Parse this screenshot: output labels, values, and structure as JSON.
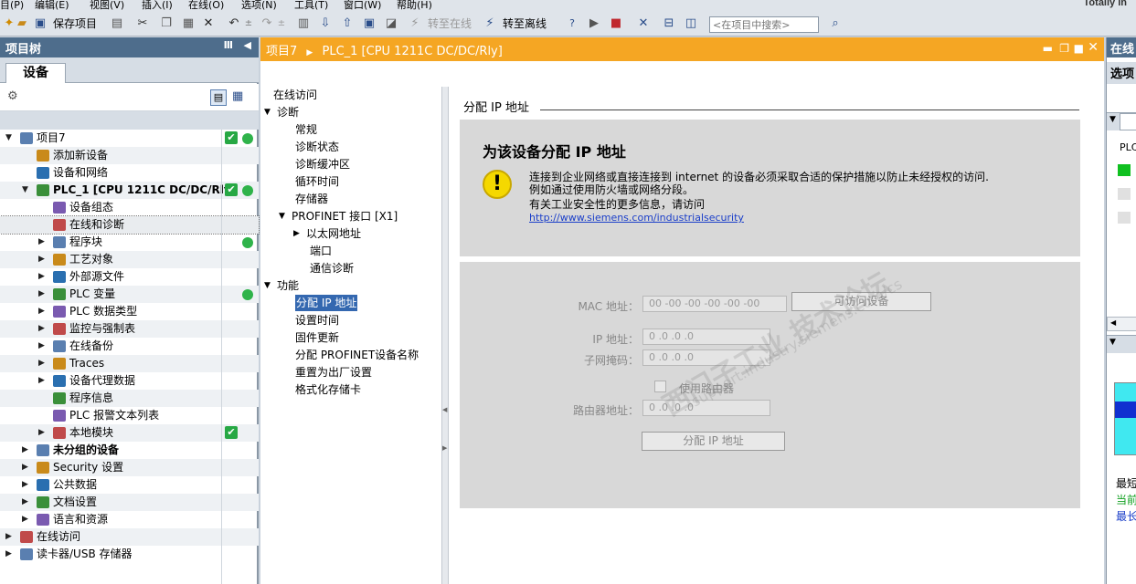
{
  "menu": [
    "目(P)",
    "编辑(E)",
    "视图(V)",
    "插入(I)",
    "在线(O)",
    "选项(N)",
    "工具(T)",
    "窗口(W)",
    "帮助(H)"
  ],
  "brand": "Totally In",
  "toolbar": {
    "save_label": "保存项目",
    "go_online": "转至在线",
    "go_offline": "转至离线",
    "search_placeholder": "<在项目中搜索>"
  },
  "left_panel": {
    "title": "项目树",
    "tab": "设备",
    "tree": [
      {
        "label": "项目7",
        "indent": 0,
        "expanded": true,
        "check": true,
        "dot": true
      },
      {
        "label": "添加新设备",
        "indent": 1
      },
      {
        "label": "设备和网络",
        "indent": 1
      },
      {
        "label": "PLC_1 [CPU 1211C DC/DC/Rly]",
        "indent": 1,
        "expanded": true,
        "check": true,
        "dot": true,
        "bold": true
      },
      {
        "label": "设备组态",
        "indent": 2
      },
      {
        "label": "在线和诊断",
        "indent": 2,
        "selected": true
      },
      {
        "label": "程序块",
        "indent": 2,
        "collapsed": true,
        "dot": true
      },
      {
        "label": "工艺对象",
        "indent": 2,
        "collapsed": true
      },
      {
        "label": "外部源文件",
        "indent": 2,
        "collapsed": true
      },
      {
        "label": "PLC 变量",
        "indent": 2,
        "collapsed": true,
        "dot": true
      },
      {
        "label": "PLC 数据类型",
        "indent": 2,
        "collapsed": true
      },
      {
        "label": "监控与强制表",
        "indent": 2,
        "collapsed": true
      },
      {
        "label": "在线备份",
        "indent": 2,
        "collapsed": true
      },
      {
        "label": "Traces",
        "indent": 2,
        "collapsed": true
      },
      {
        "label": "设备代理数据",
        "indent": 2,
        "collapsed": true
      },
      {
        "label": "程序信息",
        "indent": 2
      },
      {
        "label": "PLC 报警文本列表",
        "indent": 2
      },
      {
        "label": "本地模块",
        "indent": 2,
        "collapsed": true,
        "check": true
      },
      {
        "label": "未分组的设备",
        "indent": 1,
        "collapsed": true,
        "bold": true
      },
      {
        "label": "Security 设置",
        "indent": 1,
        "collapsed": true
      },
      {
        "label": "公共数据",
        "indent": 1,
        "collapsed": true
      },
      {
        "label": "文档设置",
        "indent": 1,
        "collapsed": true
      },
      {
        "label": "语言和资源",
        "indent": 1,
        "collapsed": true
      },
      {
        "label": "在线访问",
        "indent": 0,
        "collapsed": true
      },
      {
        "label": "读卡器/USB 存储器",
        "indent": 0,
        "collapsed": true
      }
    ]
  },
  "editor": {
    "breadcrumb_project": "项目7",
    "breadcrumb_device": "PLC_1 [CPU 1211C DC/DC/Rly]",
    "nav": [
      {
        "label": "在线访问",
        "indent": 0
      },
      {
        "label": "诊断",
        "indent": 0,
        "expanded": true
      },
      {
        "label": "常规",
        "indent": 1
      },
      {
        "label": "诊断状态",
        "indent": 1
      },
      {
        "label": "诊断缓冲区",
        "indent": 1
      },
      {
        "label": "循环时间",
        "indent": 1
      },
      {
        "label": "存储器",
        "indent": 1
      },
      {
        "label": "PROFINET 接口 [X1]",
        "indent": 1,
        "expanded": true
      },
      {
        "label": "以太网地址",
        "indent": 2,
        "collapsed": true
      },
      {
        "label": "端口",
        "indent": 2
      },
      {
        "label": "通信诊断",
        "indent": 2
      },
      {
        "label": "功能",
        "indent": 0,
        "expanded": true
      },
      {
        "label": "分配 IP 地址",
        "indent": 1,
        "selected": true
      },
      {
        "label": "设置时间",
        "indent": 1
      },
      {
        "label": "固件更新",
        "indent": 1
      },
      {
        "label": "分配 PROFINET设备名称",
        "indent": 1
      },
      {
        "label": "重置为出厂设置",
        "indent": 1
      },
      {
        "label": "格式化存储卡",
        "indent": 1
      }
    ],
    "section_title": "分配 IP 地址",
    "heading": "为该设备分配 IP 地址",
    "warning_line1": "连接到企业网络或直接连接到 internet 的设备必须采取合适的保护措施以防止未经授权的访问.",
    "warning_line2": "例如通过使用防火墙或网络分段。",
    "warning_line3": "有关工业安全性的更多信息，请访问",
    "warning_link": "http://www.siemens.com/industrialsecurity",
    "mac_label": "MAC 地址：",
    "mac_value": "00 -00 -00 -00 -00 -00",
    "accessible_devices_button": "可访问设备",
    "ip_label": "IP 地址：",
    "ip_value": "0    .0    .0    .0",
    "subnet_label": "子网掩码：",
    "subnet_value": "0    .0    .0    .0",
    "use_router_label": "使用路由器",
    "router_label": "路由器地址：",
    "router_value": "0    .0    .0    .0",
    "assign_button": "分配 IP 地址",
    "watermark": "西门子工业 技术论坛",
    "watermark_url": "support.industry.siemens.com/cs"
  },
  "right_panel": {
    "title": "在线",
    "tab": "选项",
    "item_plc": "PLC",
    "item_a": "最短",
    "item_b": "当前",
    "item_c": "最长"
  },
  "colors": {
    "header_blue": "#4e6d8c",
    "editor_orange": "#f5a623",
    "status_green": "#27a844",
    "select_blue": "#3468b0"
  }
}
